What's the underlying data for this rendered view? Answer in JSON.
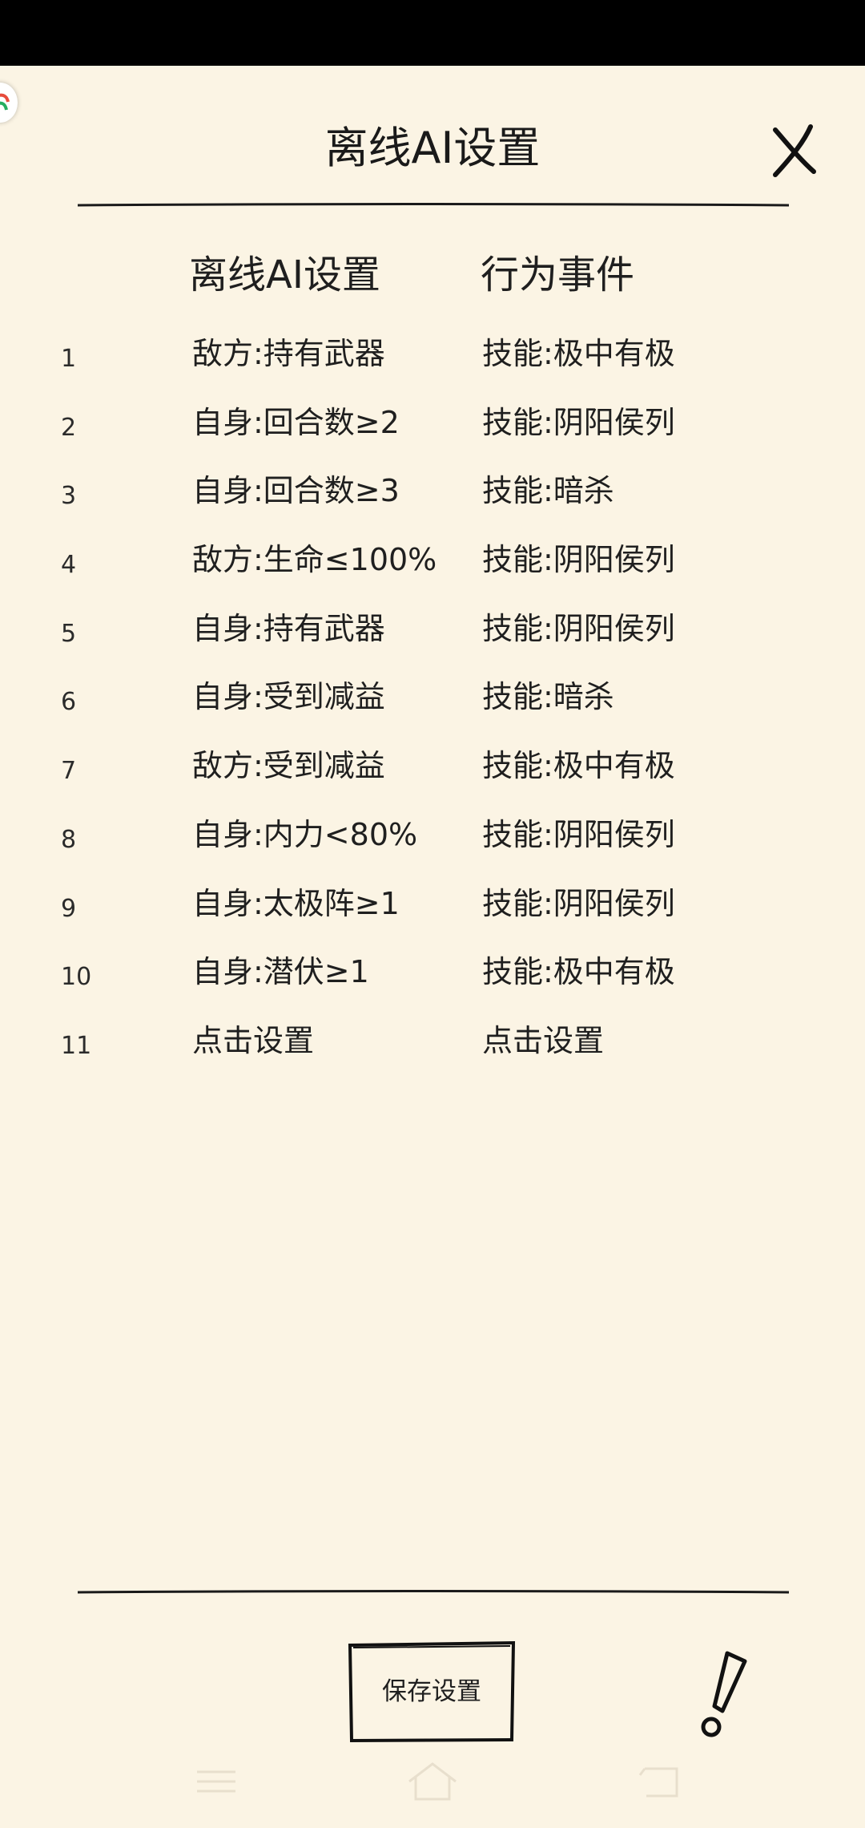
{
  "header": {
    "title": "离线AI设置"
  },
  "columns": {
    "condition": "离线AI设置",
    "action": "行为事件"
  },
  "rules": [
    {
      "index": "1",
      "condition": "敌方:持有武器",
      "action": "技能:极中有极"
    },
    {
      "index": "2",
      "condition": "自身:回合数≥2",
      "action": "技能:阴阳侯列"
    },
    {
      "index": "3",
      "condition": "自身:回合数≥3",
      "action": "技能:暗杀"
    },
    {
      "index": "4",
      "condition": "敌方:生命≤100%",
      "action": "技能:阴阳侯列"
    },
    {
      "index": "5",
      "condition": "自身:持有武器",
      "action": "技能:阴阳侯列"
    },
    {
      "index": "6",
      "condition": "自身:受到减益",
      "action": "技能:暗杀"
    },
    {
      "index": "7",
      "condition": "敌方:受到减益",
      "action": "技能:极中有极"
    },
    {
      "index": "8",
      "condition": "自身:内力<80%",
      "action": "技能:阴阳侯列"
    },
    {
      "index": "9",
      "condition": "自身:太极阵≥1",
      "action": "技能:阴阳侯列"
    },
    {
      "index": "10",
      "condition": "自身:潜伏≥1",
      "action": "技能:极中有极"
    },
    {
      "index": "11",
      "condition": "点击设置",
      "action": "点击设置"
    }
  ],
  "footer": {
    "save_label": "保存设置"
  },
  "icons": {
    "close": "close-icon",
    "alert": "exclamation-icon",
    "nav_menu": "menu-icon",
    "nav_home": "home-icon",
    "nav_back": "back-icon"
  },
  "colors": {
    "background": "#fbf4e4",
    "text": "#1f1f1f",
    "status_bar": "#000000"
  }
}
